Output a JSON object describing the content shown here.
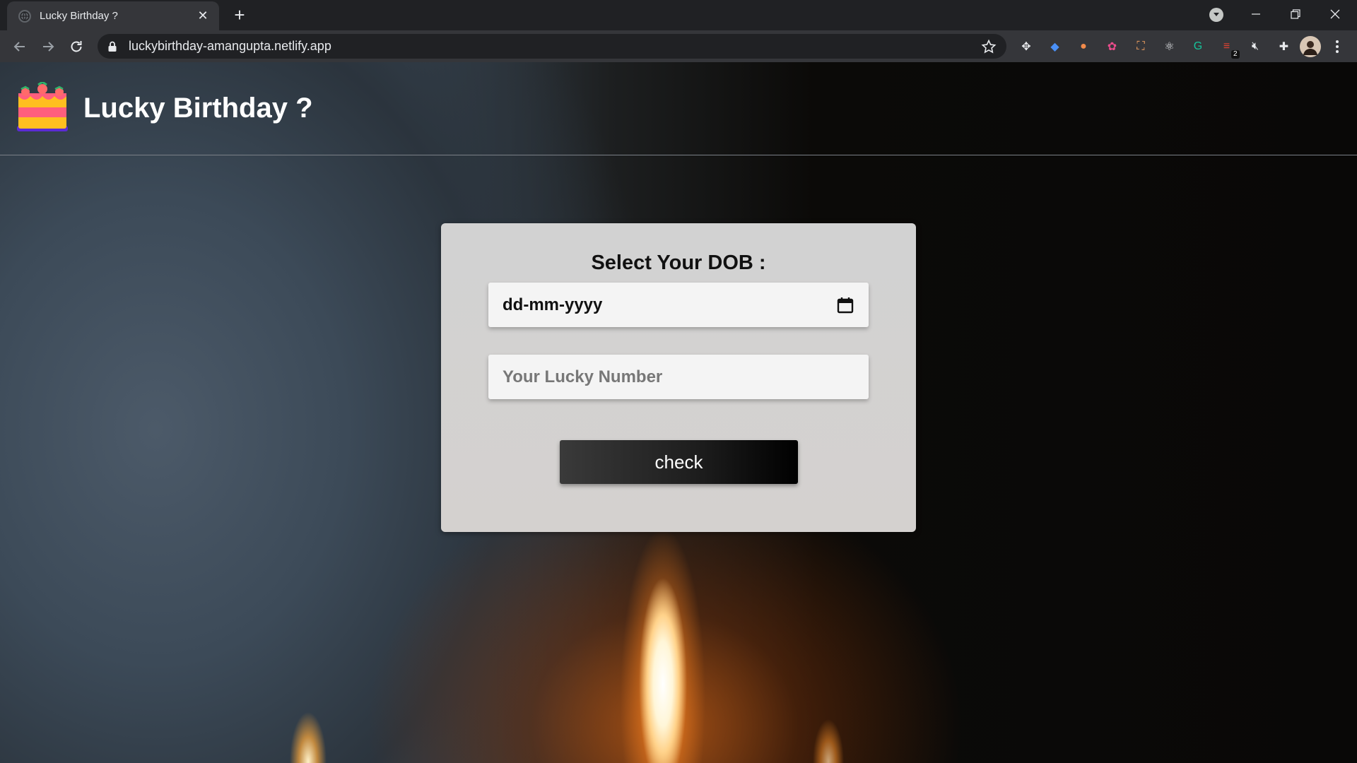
{
  "browser": {
    "tab": {
      "title": "Lucky Birthday ?",
      "close_glyph": "✕",
      "favicon": "globe-icon"
    },
    "new_tab_glyph": "+",
    "window_controls": {
      "minimize_glyph": "—",
      "maximize_glyph": "❐",
      "close_glyph": "✕"
    },
    "address_bar": {
      "url": "luckybirthday-amangupta.netlify.app"
    },
    "extensions": [
      {
        "name": "move-icon",
        "glyph": "✥"
      },
      {
        "name": "drop-icon",
        "glyph": "◆",
        "color": "#4a90f7"
      },
      {
        "name": "capsule-icon",
        "glyph": "●",
        "color": "#f28b4b"
      },
      {
        "name": "color-wheel-icon",
        "glyph": "✿",
        "color": "#e94c8b"
      },
      {
        "name": "screenshot-icon",
        "glyph": "⛶",
        "color": "#f0a060"
      },
      {
        "name": "react-atom-icon",
        "glyph": "⚛",
        "color": "#e8eaed"
      },
      {
        "name": "grammarly-icon",
        "glyph": "G",
        "color": "#15c39a"
      },
      {
        "name": "todoist-icon",
        "glyph": "≡",
        "color": "#e44332",
        "badge": "2"
      },
      {
        "name": "mute-icon",
        "glyph": "🔇︎",
        "color": "#e8eaed"
      },
      {
        "name": "puzzle-icon",
        "glyph": "✚",
        "color": "#e8eaed"
      }
    ]
  },
  "page": {
    "header": {
      "title": "Lucky Birthday ?"
    },
    "form": {
      "dob_label": "Select Your DOB :",
      "date_placeholder": "dd-mm-yyyy",
      "lucky_number_placeholder": "Your Lucky Number",
      "check_label": "check"
    }
  }
}
